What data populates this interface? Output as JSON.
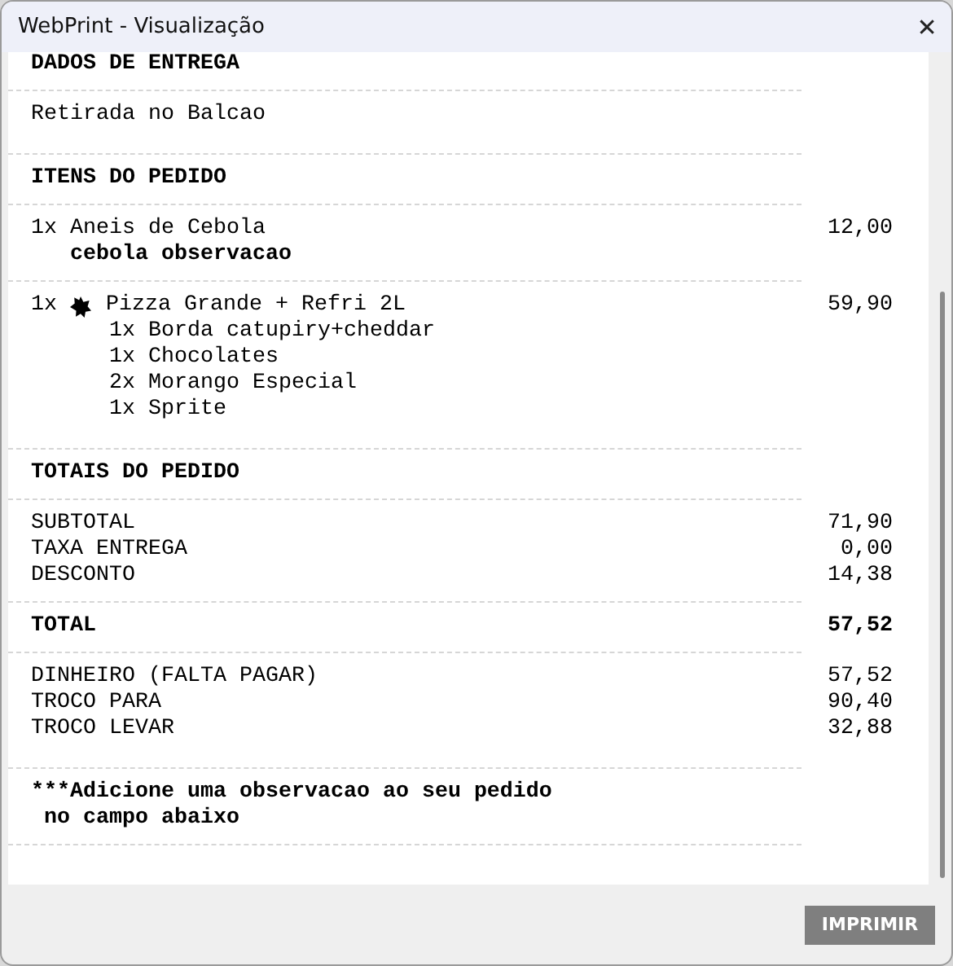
{
  "window": {
    "title": "WebPrint - Visualização",
    "close": "✕"
  },
  "receipt": [
    {
      "kind": "heading",
      "text": "DADOS DE ENTREGA"
    },
    {
      "kind": "text",
      "lines": [
        "Retirada no Balcao"
      ]
    },
    {
      "kind": "heading",
      "text": "ITENS DO PEDIDO"
    },
    {
      "kind": "item",
      "qty": "1x",
      "starred": false,
      "name": "Aneis de Cebola",
      "price": "12,00",
      "note": "cebola observacao"
    },
    {
      "kind": "item",
      "qty": "1x",
      "starred": true,
      "name": "Pizza Grande + Refri 2L",
      "price": "59,90",
      "subitems": [
        "1x Borda catupiry+cheddar",
        "1x Chocolates",
        "2x Morango Especial",
        "1x Sprite"
      ]
    },
    {
      "kind": "heading",
      "text": "TOTAIS DO PEDIDO"
    },
    {
      "kind": "totals",
      "bold": false,
      "rows": [
        {
          "label": "SUBTOTAL",
          "value": "71,90"
        },
        {
          "label": "TAXA ENTREGA",
          "value": "0,00"
        },
        {
          "label": "DESCONTO",
          "value": "14,38"
        }
      ]
    },
    {
      "kind": "totals",
      "bold": true,
      "rows": [
        {
          "label": "TOTAL",
          "value": "57,52"
        }
      ]
    },
    {
      "kind": "totals",
      "bold": false,
      "rows": [
        {
          "label": "DINHEIRO (FALTA PAGAR)",
          "value": "57,52"
        },
        {
          "label": "TROCO PARA",
          "value": "90,40"
        },
        {
          "label": "TROCO LEVAR",
          "value": "32,88"
        }
      ]
    },
    {
      "kind": "note",
      "lines": [
        "***Adicione uma observacao ao seu pedido",
        " no campo abaixo"
      ]
    }
  ],
  "buttons": [
    "IMPRIMIR"
  ]
}
